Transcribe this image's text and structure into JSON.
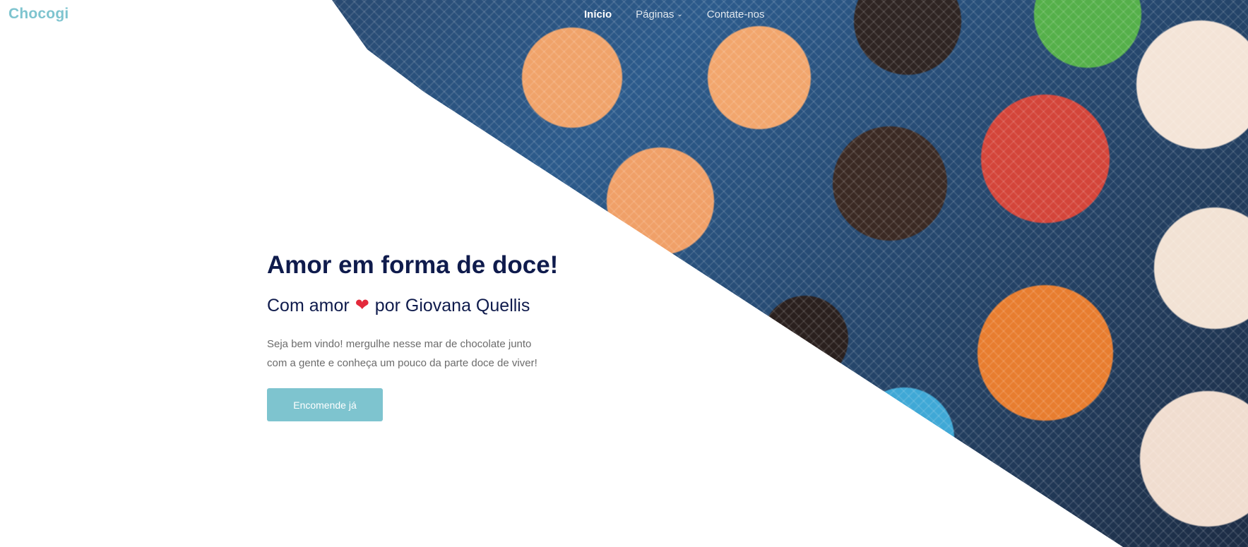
{
  "header": {
    "brand": "Chocogi",
    "nav": [
      {
        "label": "Início",
        "active": true
      },
      {
        "label": "Páginas",
        "has_dropdown": true
      },
      {
        "label": "Contate-nos"
      }
    ]
  },
  "hero": {
    "title": "Amor em forma de doce!",
    "subtitle_before": "Com amor",
    "subtitle_after": "por Giovana Quellis",
    "heart_icon": "heart-icon",
    "description": "Seja bem vindo! mergulhe nesse mar de chocolate junto com a gente e conheça um pouco da parte doce de viver!",
    "cta_label": "Encomende já"
  },
  "colors": {
    "accent": "#7ec4cf",
    "title": "#0f1b4c",
    "heart": "#e3293b",
    "body_text": "#6b6b6b"
  }
}
